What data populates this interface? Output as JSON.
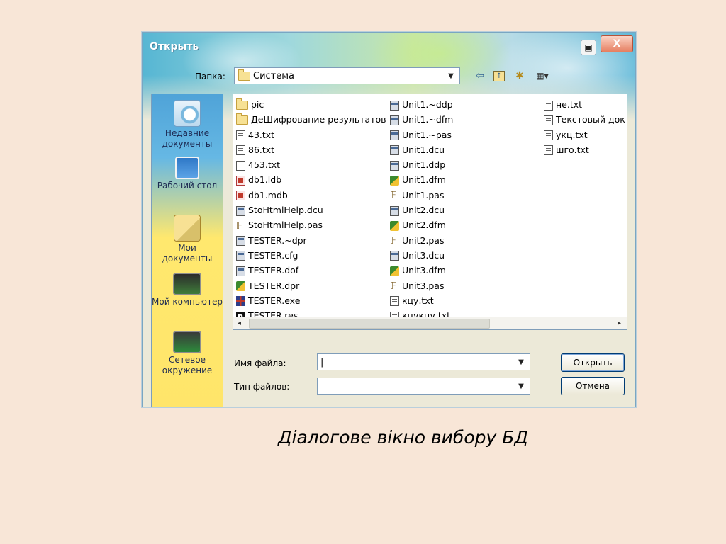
{
  "window": {
    "title": "Открыть",
    "help_button": "▣",
    "close_button": "X"
  },
  "toolbar": {
    "folder_label": "Папка:",
    "folder_value": "Система",
    "back_icon": "back-arrow-icon",
    "up_icon": "up-folder-icon",
    "new_folder_icon": "new-folder-icon",
    "view_icon": "view-menu-icon"
  },
  "places": [
    {
      "label": "Недавние документы",
      "icon": "recent-documents-icon"
    },
    {
      "label": "Рабочий стол",
      "icon": "desktop-icon"
    },
    {
      "label": "Мои документы",
      "icon": "my-documents-icon"
    },
    {
      "label": "Мой компьютер",
      "icon": "my-computer-icon"
    },
    {
      "label": "Сетевое окружение",
      "icon": "network-icon"
    }
  ],
  "files": {
    "col1": [
      {
        "name": "pic",
        "type": "folder"
      },
      {
        "name": "ДеШифрование результатов",
        "type": "folder"
      },
      {
        "name": "43.txt",
        "type": "txt"
      },
      {
        "name": "86.txt",
        "type": "txt"
      },
      {
        "name": "453.txt",
        "type": "txt"
      },
      {
        "name": "db1.ldb",
        "type": "mdb"
      },
      {
        "name": "db1.mdb",
        "type": "mdb"
      },
      {
        "name": "StoHtmlHelp.dcu",
        "type": "bin"
      },
      {
        "name": "StoHtmlHelp.pas",
        "type": "pas"
      },
      {
        "name": "TESTER.~dpr",
        "type": "bin"
      },
      {
        "name": "TESTER.cfg",
        "type": "bin"
      },
      {
        "name": "TESTER.dof",
        "type": "bin"
      },
      {
        "name": "TESTER.dpr",
        "type": "dfm"
      },
      {
        "name": "TESTER.exe",
        "type": "exe"
      },
      {
        "name": "TESTER.res",
        "type": "res"
      }
    ],
    "col2": [
      {
        "name": "Unit1.~ddp",
        "type": "bin"
      },
      {
        "name": "Unit1.~dfm",
        "type": "bin"
      },
      {
        "name": "Unit1.~pas",
        "type": "bin"
      },
      {
        "name": "Unit1.dcu",
        "type": "bin"
      },
      {
        "name": "Unit1.ddp",
        "type": "bin"
      },
      {
        "name": "Unit1.dfm",
        "type": "dfm"
      },
      {
        "name": "Unit1.pas",
        "type": "pas"
      },
      {
        "name": "Unit2.dcu",
        "type": "bin"
      },
      {
        "name": "Unit2.dfm",
        "type": "dfm"
      },
      {
        "name": "Unit2.pas",
        "type": "pas"
      },
      {
        "name": "Unit3.dcu",
        "type": "bin"
      },
      {
        "name": "Unit3.dfm",
        "type": "dfm"
      },
      {
        "name": "Unit3.pas",
        "type": "pas"
      },
      {
        "name": "кцу.txt",
        "type": "txt"
      },
      {
        "name": "кцукцу.txt",
        "type": "txt"
      }
    ],
    "col3": [
      {
        "name": "не.txt",
        "type": "txt"
      },
      {
        "name": "Текстовый док",
        "type": "txt"
      },
      {
        "name": "укц.txt",
        "type": "txt"
      },
      {
        "name": "шго.txt",
        "type": "txt"
      }
    ]
  },
  "form": {
    "filename_label": "Имя файла:",
    "filename_value": "",
    "filetype_label": "Тип файлов:",
    "filetype_value": ""
  },
  "buttons": {
    "open": "Открыть",
    "cancel": "Отмена"
  },
  "caption": "Діалогове вікно вибору БД"
}
